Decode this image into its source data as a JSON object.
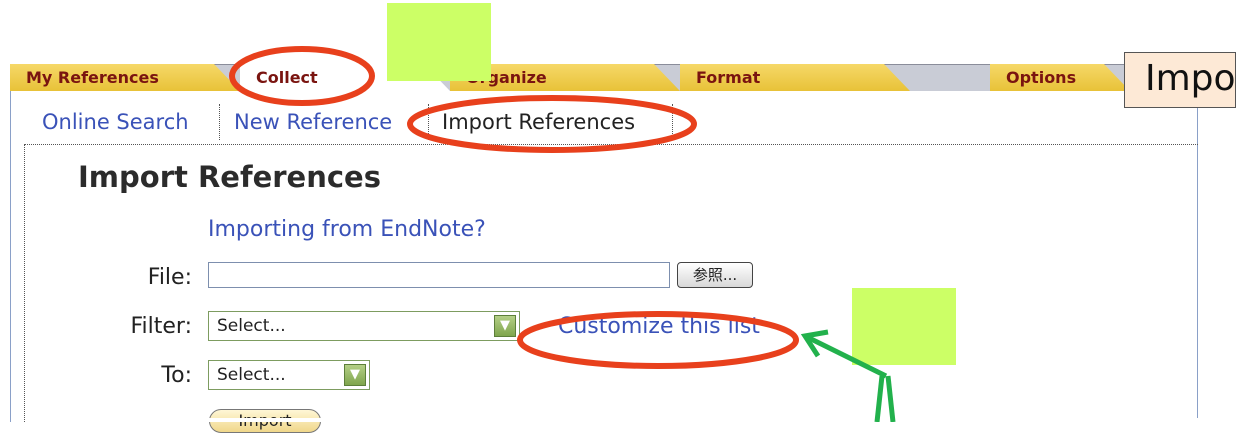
{
  "tabs": [
    {
      "label": "My References"
    },
    {
      "label": "Collect"
    },
    {
      "label": "Organize"
    },
    {
      "label": "Format"
    },
    {
      "label": "Options"
    }
  ],
  "subtabs": [
    {
      "label": "Online Search"
    },
    {
      "label": "New Reference"
    },
    {
      "label": "Import References"
    }
  ],
  "page": {
    "title": "Import References",
    "endnote_link": "Importing from EndNote?"
  },
  "form": {
    "file_label": "File:",
    "browse_label": "参照...",
    "filter_label": "Filter:",
    "filter_value": "Select...",
    "customize_link": "Customize this list",
    "to_label": "To:",
    "to_value": "Select...",
    "import_label": "Import"
  },
  "callout": {
    "text": "Import"
  },
  "colors": {
    "annotation_red": "#e8401c",
    "annotation_green": "#22b14c",
    "highlight_square": "#ccff66"
  }
}
